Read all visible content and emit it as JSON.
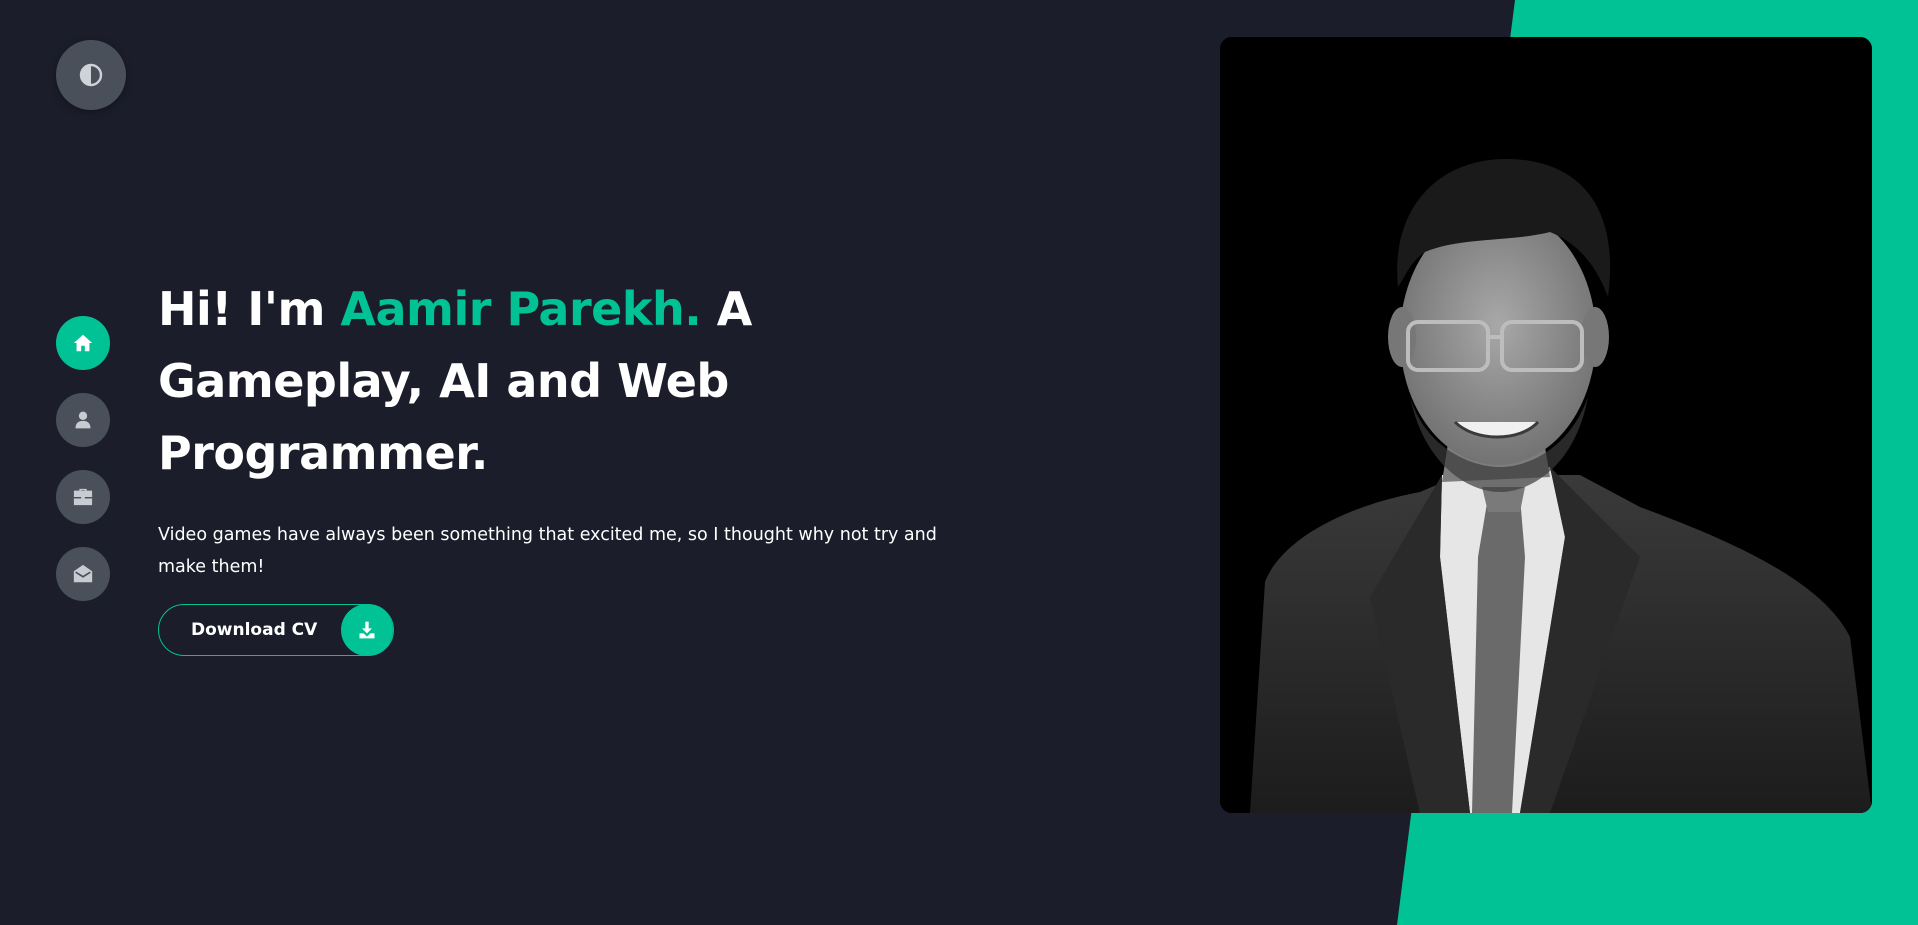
{
  "theme_toggle": {
    "icon": "contrast-icon"
  },
  "nav": [
    {
      "icon": "home-icon",
      "active": true
    },
    {
      "icon": "user-icon",
      "active": false
    },
    {
      "icon": "briefcase-icon",
      "active": false
    },
    {
      "icon": "envelope-open-icon",
      "active": false
    }
  ],
  "hero": {
    "greeting": "Hi! I'm",
    "name": "Aamir Parekh.",
    "role": "A Gameplay, AI and Web Programmer.",
    "description": "Video games have always been something that excited me, so I thought why not try and make them!"
  },
  "cta": {
    "label": "Download CV",
    "icon": "download-icon"
  },
  "colors": {
    "background": "#1b1d2b",
    "accent": "#01c295",
    "button": "#4a5059",
    "text": "#ffffff"
  }
}
